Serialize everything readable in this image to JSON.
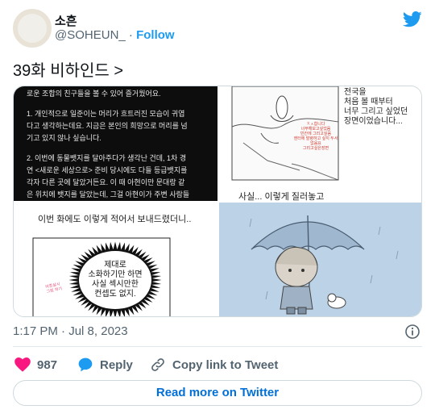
{
  "user": {
    "name": "소흔",
    "handle": "@SOHEUN_",
    "separator": "·",
    "follow_label": "Follow"
  },
  "tweet": {
    "text": "39화 비하인드 >"
  },
  "media": {
    "panel1_lines": [
      "로운 조합의 친구들을 볼 수 있어 즐거웠어요.",
      "",
      "1. 개인적으로 일준이는 머리가 흐트러진 모습이 귀엽",
      "다고 생각하는데요. 지금은 본인의 희망으로 머리를 넘",
      "기고 있지 않나 싶습니다.",
      "",
      "2. 이번에 동물뱃지를 달아주다가 생각난 건데, 1차 경",
      "연 <새로운 세상으로> 준비 당시에도 다들 등급뱃지를",
      "각자 다른 곳에 달았거든요. 이 때 아현이만 문대랑 같",
      "은 위치에 뱃지를 달았는데, 그걸 아현이가 주변 사람들"
    ],
    "panel2_caption": [
      "전국을",
      "처음 볼 때부터",
      "너무 그리고 싶었던",
      "장면이었습니다..."
    ],
    "panel2_red": [
      "ㅈㅅ합니다",
      "너무해보고싶었음",
      "빈칸에 그리고싶음",
      "엔터에 발령하고 싶지 두서없음요",
      "그리고싶은장면"
    ],
    "panel2_bottom": "사실... 이렇게 질러놓고",
    "panel3_top": "이번 화에도 이렇게 적어서 보내드렸더니..",
    "panel3_bubble": [
      "제대로",
      "소화하기만 하면",
      "사실 섹시만한",
      "컨셉도 없지."
    ],
    "panel3_pink": [
      "마흔살시",
      "그림 하기"
    ]
  },
  "meta": {
    "time": "1:17 PM",
    "separator": "·",
    "date": "Jul 8, 2023"
  },
  "actions": {
    "likes": "987",
    "reply_label": "Reply",
    "copy_label": "Copy link to Tweet"
  },
  "read_more_label": "Read more on Twitter",
  "colors": {
    "accent": "#1d9bf0",
    "like": "#f91880",
    "text": "#0f1419",
    "muted": "#536471",
    "link": "#006fd6"
  }
}
